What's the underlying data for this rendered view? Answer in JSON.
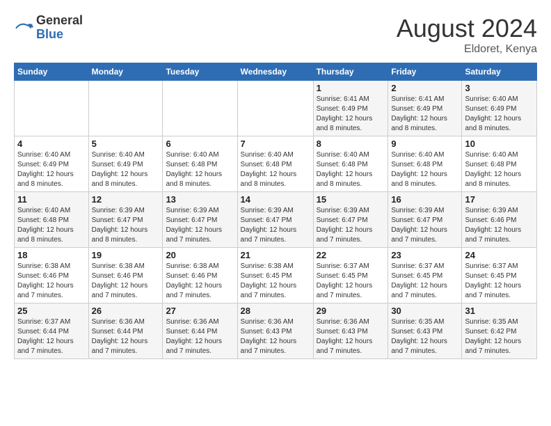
{
  "header": {
    "logo_general": "General",
    "logo_blue": "Blue",
    "month_title": "August 2024",
    "subtitle": "Eldoret, Kenya"
  },
  "calendar": {
    "days_of_week": [
      "Sunday",
      "Monday",
      "Tuesday",
      "Wednesday",
      "Thursday",
      "Friday",
      "Saturday"
    ],
    "weeks": [
      [
        {
          "day": "",
          "info": ""
        },
        {
          "day": "",
          "info": ""
        },
        {
          "day": "",
          "info": ""
        },
        {
          "day": "",
          "info": ""
        },
        {
          "day": "1",
          "info": "Sunrise: 6:41 AM\nSunset: 6:49 PM\nDaylight: 12 hours\nand 8 minutes."
        },
        {
          "day": "2",
          "info": "Sunrise: 6:41 AM\nSunset: 6:49 PM\nDaylight: 12 hours\nand 8 minutes."
        },
        {
          "day": "3",
          "info": "Sunrise: 6:40 AM\nSunset: 6:49 PM\nDaylight: 12 hours\nand 8 minutes."
        }
      ],
      [
        {
          "day": "4",
          "info": "Sunrise: 6:40 AM\nSunset: 6:49 PM\nDaylight: 12 hours\nand 8 minutes."
        },
        {
          "day": "5",
          "info": "Sunrise: 6:40 AM\nSunset: 6:49 PM\nDaylight: 12 hours\nand 8 minutes."
        },
        {
          "day": "6",
          "info": "Sunrise: 6:40 AM\nSunset: 6:48 PM\nDaylight: 12 hours\nand 8 minutes."
        },
        {
          "day": "7",
          "info": "Sunrise: 6:40 AM\nSunset: 6:48 PM\nDaylight: 12 hours\nand 8 minutes."
        },
        {
          "day": "8",
          "info": "Sunrise: 6:40 AM\nSunset: 6:48 PM\nDaylight: 12 hours\nand 8 minutes."
        },
        {
          "day": "9",
          "info": "Sunrise: 6:40 AM\nSunset: 6:48 PM\nDaylight: 12 hours\nand 8 minutes."
        },
        {
          "day": "10",
          "info": "Sunrise: 6:40 AM\nSunset: 6:48 PM\nDaylight: 12 hours\nand 8 minutes."
        }
      ],
      [
        {
          "day": "11",
          "info": "Sunrise: 6:40 AM\nSunset: 6:48 PM\nDaylight: 12 hours\nand 8 minutes."
        },
        {
          "day": "12",
          "info": "Sunrise: 6:39 AM\nSunset: 6:47 PM\nDaylight: 12 hours\nand 8 minutes."
        },
        {
          "day": "13",
          "info": "Sunrise: 6:39 AM\nSunset: 6:47 PM\nDaylight: 12 hours\nand 7 minutes."
        },
        {
          "day": "14",
          "info": "Sunrise: 6:39 AM\nSunset: 6:47 PM\nDaylight: 12 hours\nand 7 minutes."
        },
        {
          "day": "15",
          "info": "Sunrise: 6:39 AM\nSunset: 6:47 PM\nDaylight: 12 hours\nand 7 minutes."
        },
        {
          "day": "16",
          "info": "Sunrise: 6:39 AM\nSunset: 6:47 PM\nDaylight: 12 hours\nand 7 minutes."
        },
        {
          "day": "17",
          "info": "Sunrise: 6:39 AM\nSunset: 6:46 PM\nDaylight: 12 hours\nand 7 minutes."
        }
      ],
      [
        {
          "day": "18",
          "info": "Sunrise: 6:38 AM\nSunset: 6:46 PM\nDaylight: 12 hours\nand 7 minutes."
        },
        {
          "day": "19",
          "info": "Sunrise: 6:38 AM\nSunset: 6:46 PM\nDaylight: 12 hours\nand 7 minutes."
        },
        {
          "day": "20",
          "info": "Sunrise: 6:38 AM\nSunset: 6:46 PM\nDaylight: 12 hours\nand 7 minutes."
        },
        {
          "day": "21",
          "info": "Sunrise: 6:38 AM\nSunset: 6:45 PM\nDaylight: 12 hours\nand 7 minutes."
        },
        {
          "day": "22",
          "info": "Sunrise: 6:37 AM\nSunset: 6:45 PM\nDaylight: 12 hours\nand 7 minutes."
        },
        {
          "day": "23",
          "info": "Sunrise: 6:37 AM\nSunset: 6:45 PM\nDaylight: 12 hours\nand 7 minutes."
        },
        {
          "day": "24",
          "info": "Sunrise: 6:37 AM\nSunset: 6:45 PM\nDaylight: 12 hours\nand 7 minutes."
        }
      ],
      [
        {
          "day": "25",
          "info": "Sunrise: 6:37 AM\nSunset: 6:44 PM\nDaylight: 12 hours\nand 7 minutes."
        },
        {
          "day": "26",
          "info": "Sunrise: 6:36 AM\nSunset: 6:44 PM\nDaylight: 12 hours\nand 7 minutes."
        },
        {
          "day": "27",
          "info": "Sunrise: 6:36 AM\nSunset: 6:44 PM\nDaylight: 12 hours\nand 7 minutes."
        },
        {
          "day": "28",
          "info": "Sunrise: 6:36 AM\nSunset: 6:43 PM\nDaylight: 12 hours\nand 7 minutes."
        },
        {
          "day": "29",
          "info": "Sunrise: 6:36 AM\nSunset: 6:43 PM\nDaylight: 12 hours\nand 7 minutes."
        },
        {
          "day": "30",
          "info": "Sunrise: 6:35 AM\nSunset: 6:43 PM\nDaylight: 12 hours\nand 7 minutes."
        },
        {
          "day": "31",
          "info": "Sunrise: 6:35 AM\nSunset: 6:42 PM\nDaylight: 12 hours\nand 7 minutes."
        }
      ]
    ]
  }
}
